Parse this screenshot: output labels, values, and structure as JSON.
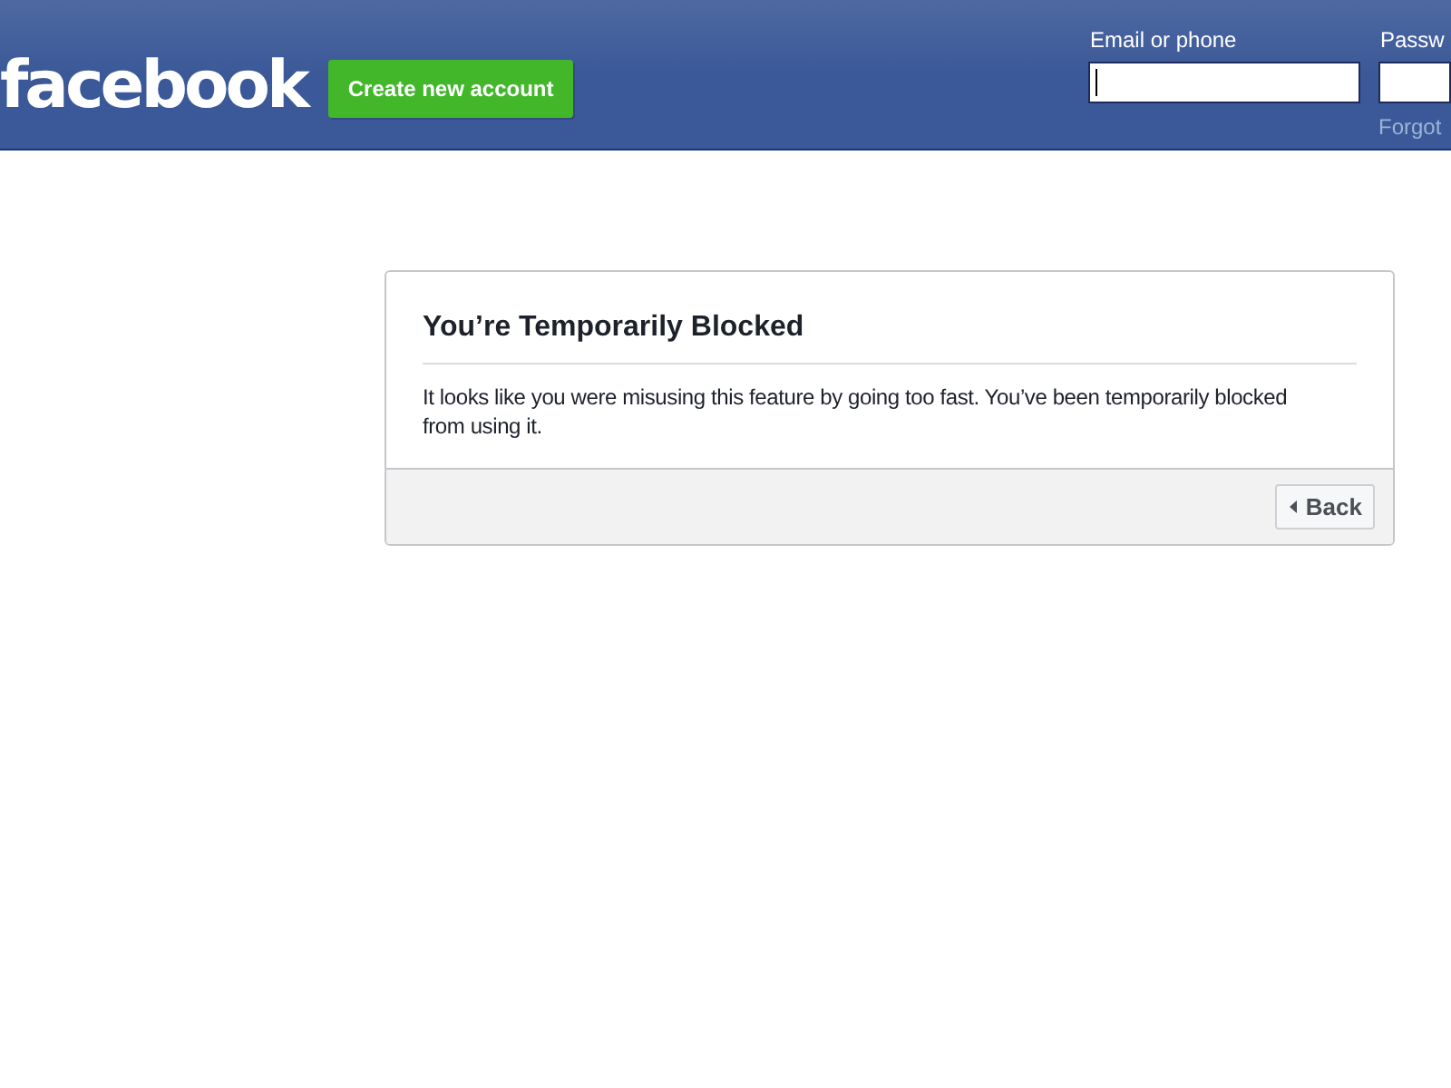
{
  "header": {
    "logo": "facebook",
    "create_account_button": "Create new account",
    "login": {
      "email": {
        "label": "Email or phone",
        "focused": true
      },
      "password": {
        "label": "Passw"
      },
      "forgot_link": "Forgot"
    }
  },
  "dialog": {
    "title": "You’re Temporarily Blocked",
    "message": "It looks like you were misusing this feature by going too fast. You’ve been temporarily blocked from using it.",
    "back_button": "Back"
  }
}
